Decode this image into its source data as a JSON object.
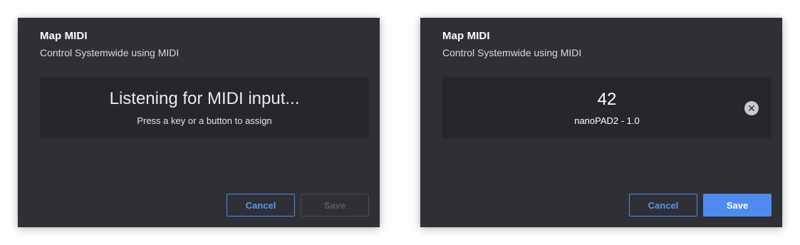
{
  "dialogs": {
    "listening": {
      "title": "Map MIDI",
      "subtitle": "Control Systemwide using MIDI",
      "heading": "Listening for MIDI input...",
      "hint": "Press a key or a button to assign",
      "cancel_label": "Cancel",
      "save_label": "Save",
      "save_enabled": false
    },
    "assigned": {
      "title": "Map MIDI",
      "subtitle": "Control Systemwide using MIDI",
      "midi_value": "42",
      "device": "nanoPAD2 - 1.0",
      "clear_icon": "close-circle-icon",
      "cancel_label": "Cancel",
      "save_label": "Save",
      "save_enabled": true
    }
  },
  "colors": {
    "dialog_bg": "#2e3035",
    "box_bg": "#26272a",
    "accent": "#4f8bef",
    "disabled_text": "#5b5d62"
  }
}
